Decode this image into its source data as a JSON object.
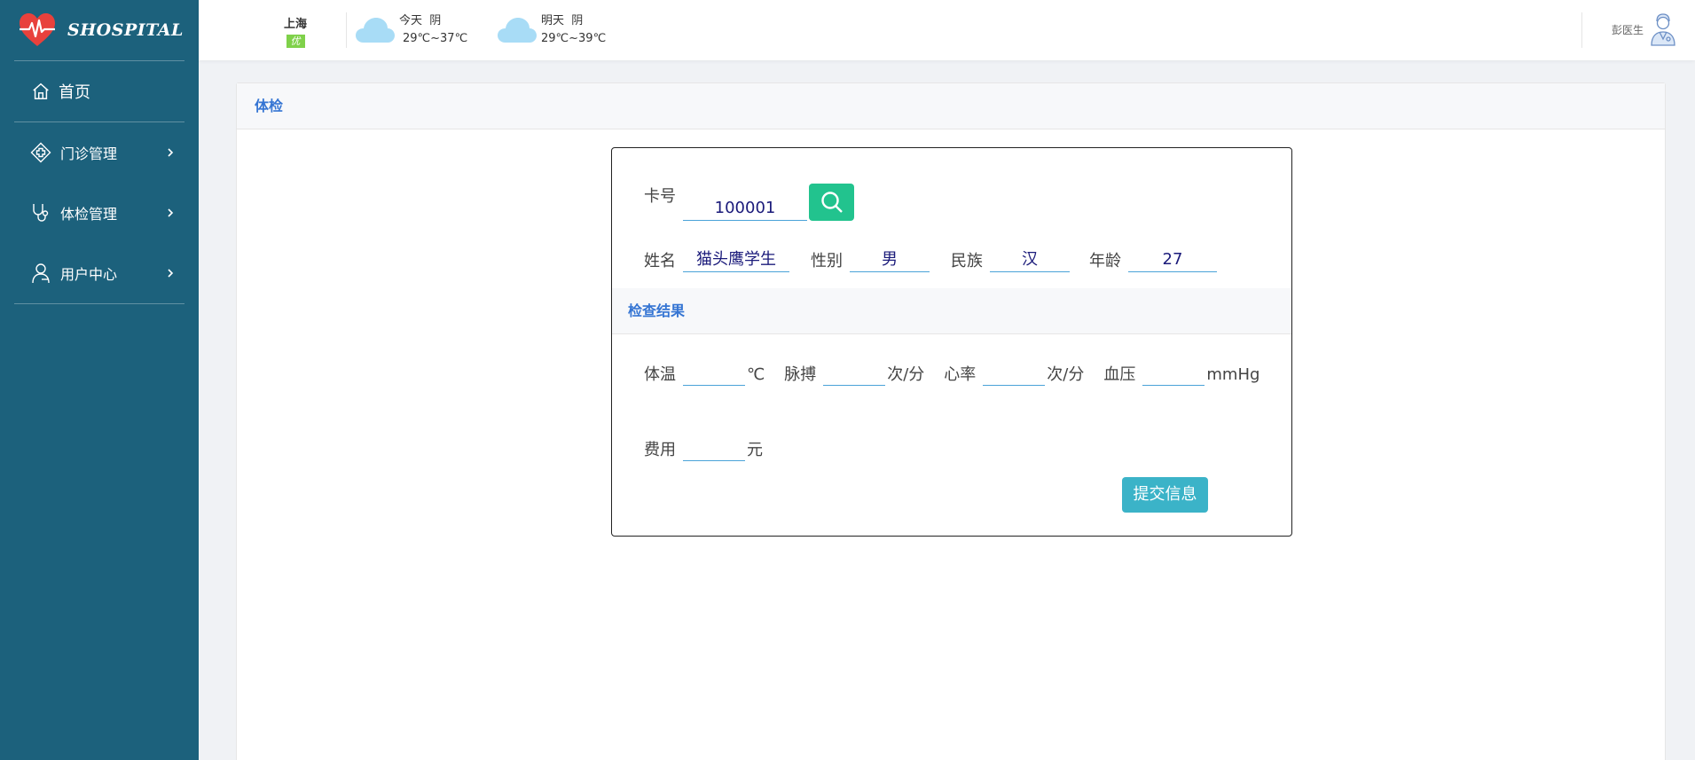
{
  "app": {
    "logo_text": "SHOSPITAL"
  },
  "sidebar": {
    "items": [
      {
        "label": "首页",
        "icon": "home-icon"
      },
      {
        "label": "门诊管理",
        "icon": "clinic-icon"
      },
      {
        "label": "体检管理",
        "icon": "stethoscope-icon"
      },
      {
        "label": "用户中心",
        "icon": "user-icon"
      }
    ]
  },
  "topbar": {
    "city": "上海",
    "aqi": "优",
    "today": {
      "label": "今天",
      "condition": "阴",
      "temp": "29℃~37℃"
    },
    "tomorrow": {
      "label": "明天",
      "condition": "阴",
      "temp": "29℃~39℃"
    },
    "user_name": "彭医生"
  },
  "panel": {
    "title": "体检"
  },
  "form": {
    "card_label": "卡号",
    "card_value": "100001",
    "name_label": "姓名",
    "name_value": "猫头鹰学生",
    "gender_label": "性别",
    "gender_value": "男",
    "ethnicity_label": "民族",
    "ethnicity_value": "汉",
    "age_label": "年龄",
    "age_value": "27",
    "section_title": "检查结果",
    "temp_label": "体温",
    "temp_unit": "℃",
    "pulse_label": "脉搏",
    "pulse_unit": "次/分",
    "heart_label": "心率",
    "heart_unit": "次/分",
    "bp_label": "血压",
    "bp_unit": "mmHg",
    "fee_label": "费用",
    "fee_unit": "元",
    "submit_label": "提交信息"
  },
  "colors": {
    "sidebar_bg": "#1c617c",
    "accent_blue": "#3575d3",
    "search_green": "#22c38e",
    "submit_teal": "#3bb3c8"
  }
}
